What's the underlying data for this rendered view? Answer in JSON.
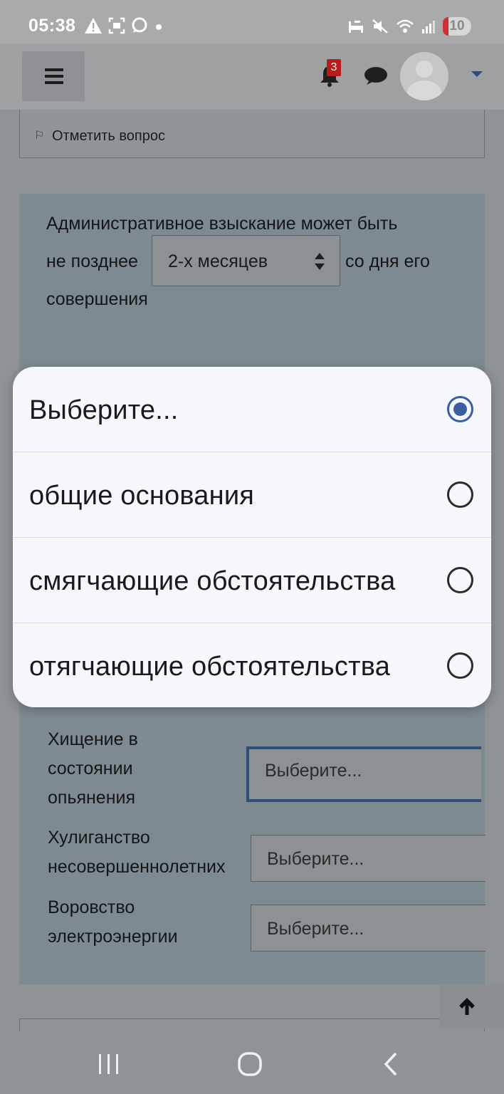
{
  "status_bar": {
    "time": "05:38",
    "battery_level": "10"
  },
  "header": {
    "notification_count": "3"
  },
  "flag_question": {
    "label": "Отметить вопрос"
  },
  "question": {
    "text_line1": "Административное взыскание может быть",
    "text_before_select": "не позднее",
    "select_value": "2-х месяцев",
    "text_after_select": "со дня его",
    "text_line3": "совершения"
  },
  "matching": {
    "rows": [
      {
        "label_lines": [
          "Хищение в",
          "состоянии",
          "опьянения"
        ],
        "value": "Выберите..."
      },
      {
        "label_lines": [
          "Хулиганство",
          "несовершеннолетних"
        ],
        "value": "Выберите..."
      },
      {
        "label_lines": [
          "Воровство",
          "электроэнергии"
        ],
        "value": "Выберите..."
      }
    ]
  },
  "dialog": {
    "options": [
      {
        "label": "Выберите...",
        "selected": true
      },
      {
        "label": "общие основания",
        "selected": false
      },
      {
        "label": "смягчающие обстоятельства",
        "selected": false
      },
      {
        "label": "отягчающие обстоятельства",
        "selected": false
      }
    ]
  }
}
